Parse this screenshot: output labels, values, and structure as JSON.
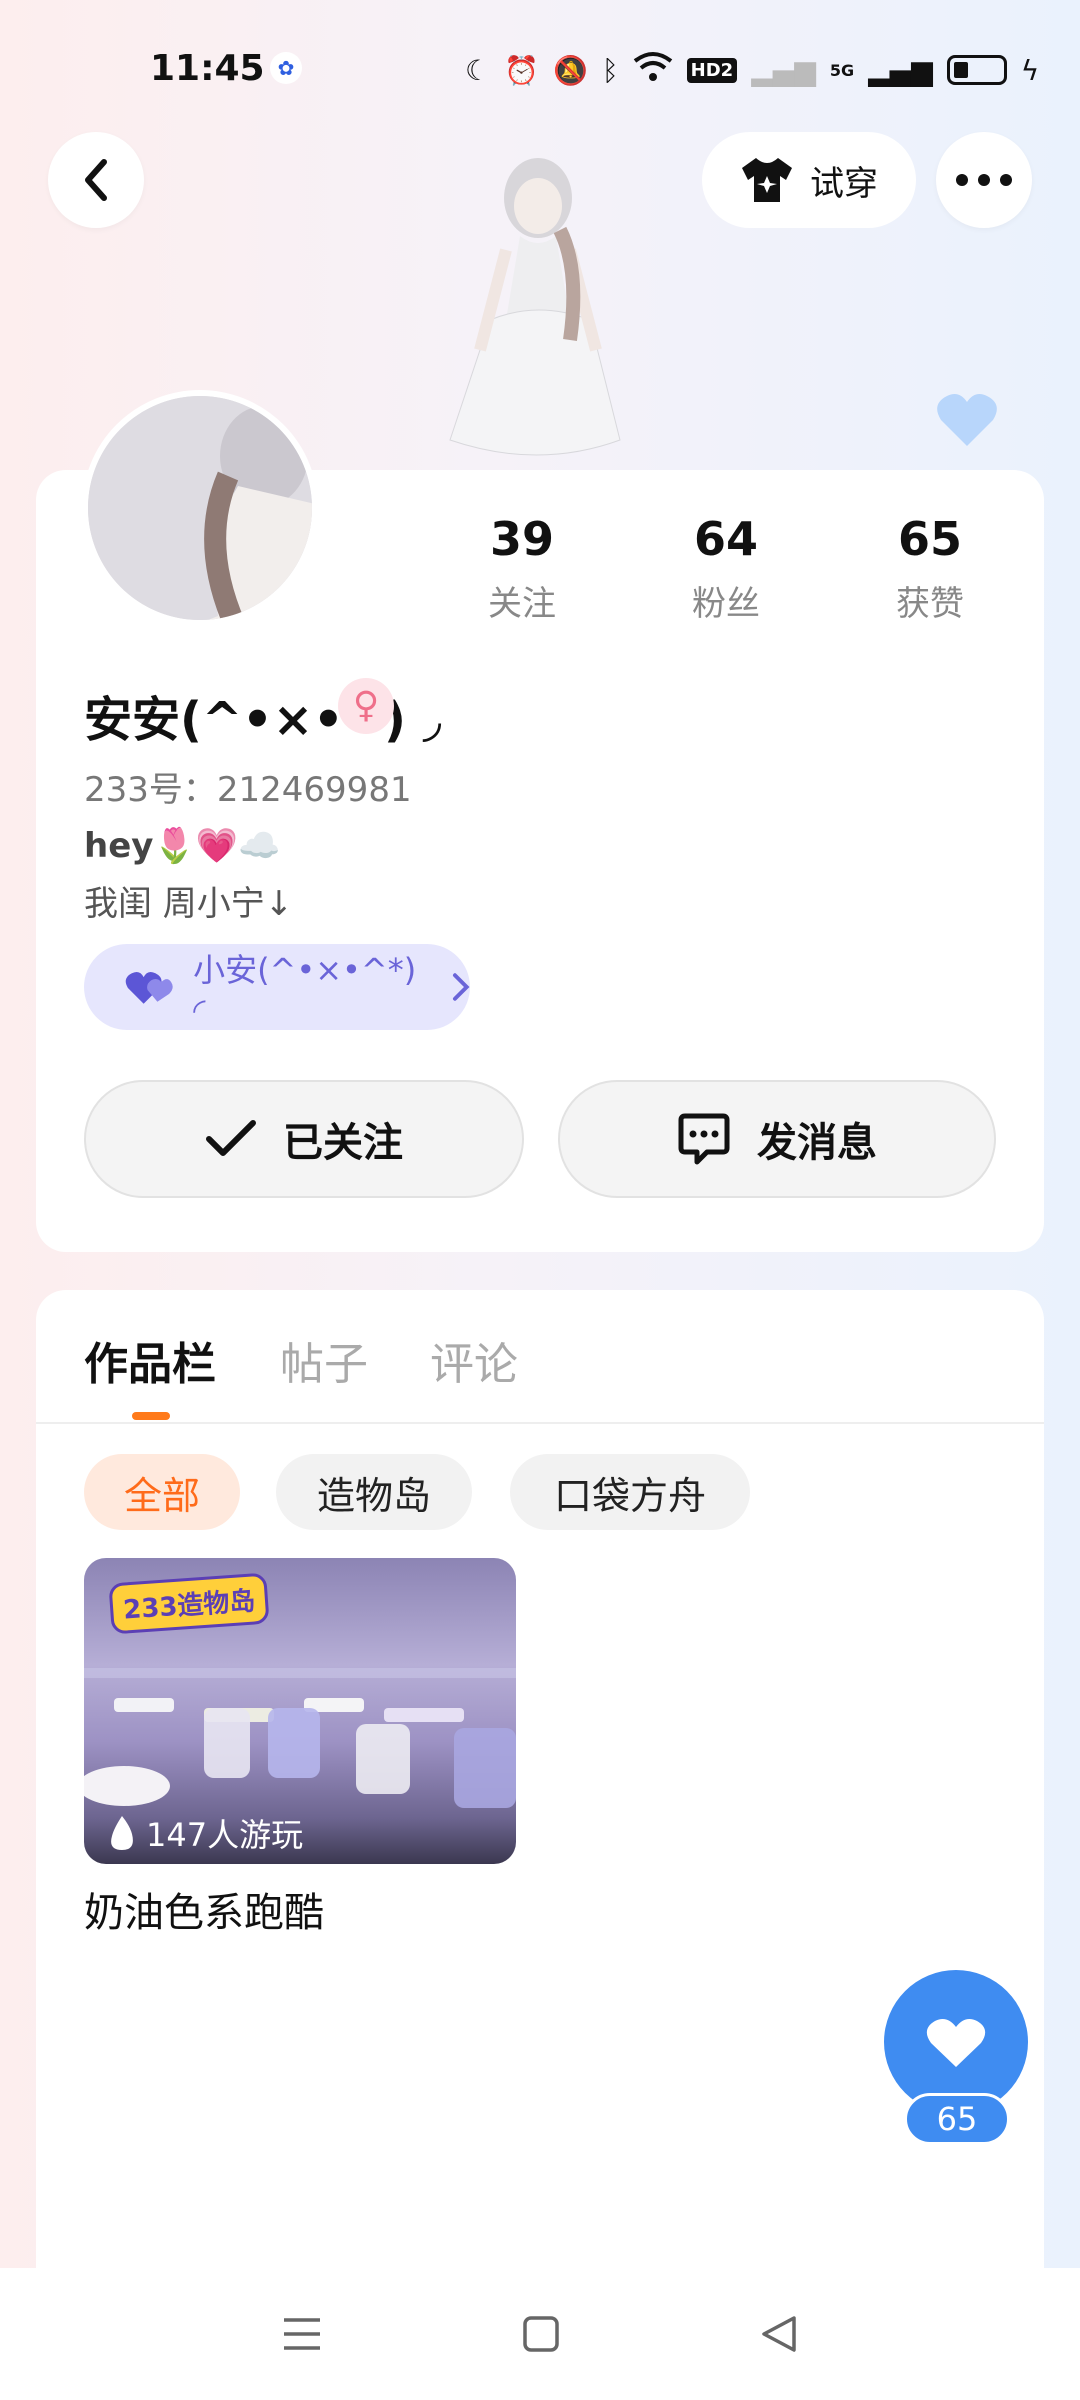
{
  "status_bar": {
    "time": "11:45",
    "network": "5G",
    "hd_label": "HD2"
  },
  "header": {
    "tryon_label": "试穿"
  },
  "stats": [
    {
      "value": "39",
      "label": "关注"
    },
    {
      "value": "64",
      "label": "粉丝"
    },
    {
      "value": "65",
      "label": "获赞"
    }
  ],
  "profile": {
    "name": "安安(^•×•^) ◞",
    "gender_symbol": "♀",
    "uid": "233号：212469981",
    "bio_line1": "hey🌷💗☁️",
    "bio_line2": "我闺 周小宁↓",
    "linked_friend": "小安(^•×•^*) ◜"
  },
  "actions": {
    "following_label": "已关注",
    "message_label": "发消息"
  },
  "tabs": [
    {
      "label": "作品栏",
      "active": true
    },
    {
      "label": "帖子",
      "active": false
    },
    {
      "label": "评论",
      "active": false
    }
  ],
  "filters": [
    {
      "label": "全部",
      "active": true
    },
    {
      "label": "造物岛",
      "active": false
    },
    {
      "label": "口袋方舟",
      "active": false
    }
  ],
  "works": [
    {
      "badge": "233造物岛",
      "plays": "147人游玩",
      "title": "奶油色系跑酷"
    }
  ],
  "like_fab": {
    "count": "65"
  },
  "colors": {
    "accent_orange": "#ff7a1a",
    "like_blue": "#3f8cf1",
    "tag_purple": "#6a64d8"
  }
}
